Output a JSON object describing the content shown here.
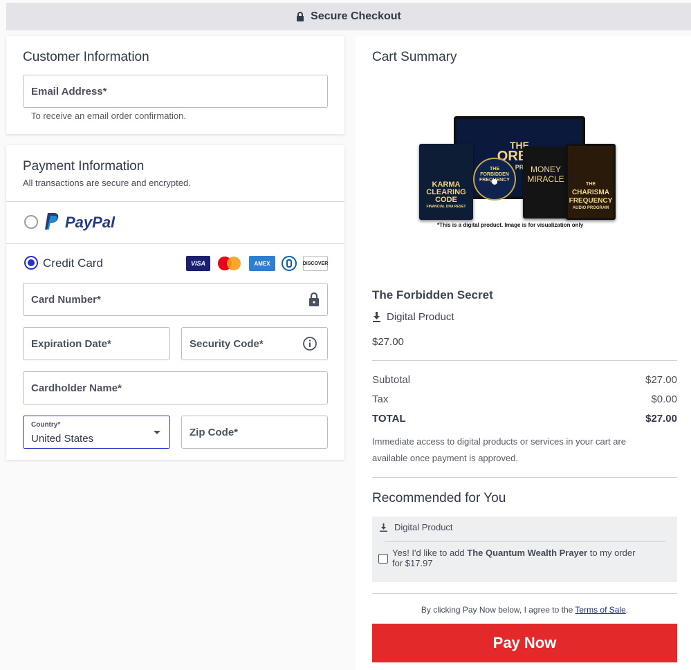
{
  "header": {
    "title": "Secure Checkout"
  },
  "customer": {
    "title": "Customer Information",
    "email_label": "Email Address*",
    "email_helper": "To receive an email order confirmation."
  },
  "payment": {
    "title": "Payment Information",
    "subtitle": "All transactions are secure and encrypted.",
    "paypal_label": "PayPal",
    "credit_label": "Credit Card",
    "card_logos": [
      "VISA",
      "MASTERCARD",
      "AMEX",
      "DINERS",
      "DISCOVER"
    ],
    "card_number_label": "Card Number*",
    "expiration_label": "Expiration Date*",
    "security_label": "Security Code*",
    "cardholder_label": "Cardholder Name*",
    "country_label": "Country*",
    "country_value": "United States",
    "zip_label": "Zip Code*",
    "selected_method": "credit_card"
  },
  "cart": {
    "title": "Cart Summary",
    "image_caption": "*This is a digital product. Image is for visualization only",
    "product_name": "The Forbidden Secret",
    "product_type": "Digital Product",
    "product_price": "$27.00",
    "subtotal_label": "Subtotal",
    "subtotal_value": "$27.00",
    "tax_label": "Tax",
    "tax_value": "$0.00",
    "total_label": "TOTAL",
    "total_value": "$27.00",
    "access_note": "Immediate access to digital products or services in your cart are available once payment is approved."
  },
  "books": {
    "karma": [
      "KARMA",
      "CLEARING",
      "CODE",
      "FINANCIAL DNA RESET"
    ],
    "money": [
      "MONEY",
      "MIRACLE"
    ],
    "charisma": [
      "THE",
      "CHARISMA",
      "FREQUENCY",
      "AUDIO PROGRAM"
    ],
    "forbidden_disc": [
      "THE",
      "FORBIDDEN",
      "FREQUENCY"
    ],
    "screen": [
      "THE",
      "ORBID",
      "PR"
    ]
  },
  "recommended": {
    "title": "Recommended for You",
    "type": "Digital Product",
    "offer_prefix": "Yes! I'd like to add ",
    "offer_product": "The Quantum Wealth Prayer",
    "offer_suffix": " to my order",
    "offer_price": "for $17.97"
  },
  "terms": {
    "prefix": "By clicking Pay Now below, I agree to the ",
    "link": "Terms of Sale",
    "suffix": "."
  },
  "pay_button": "Pay Now",
  "colors": {
    "accent": "#2633c9",
    "pay": "#e3292a",
    "paypal_dark": "#253b80",
    "paypal_light": "#179bd7"
  }
}
